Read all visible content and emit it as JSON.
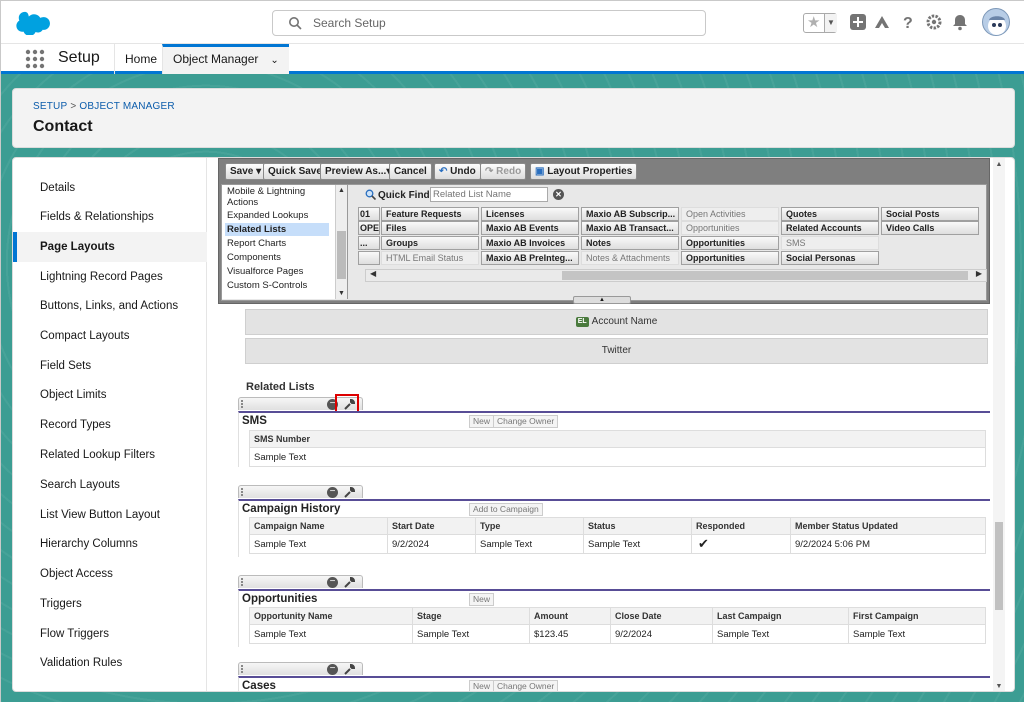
{
  "header": {
    "search_placeholder": "Search Setup",
    "icons": [
      "cloud-logo",
      "search-icon",
      "star-icon",
      "chevron-down-icon",
      "plus-icon",
      "trailhead-icon",
      "help-icon",
      "gear-icon",
      "bell-icon",
      "avatar"
    ]
  },
  "appnav": {
    "app_name": "Setup",
    "tabs": [
      {
        "label": "Home"
      },
      {
        "label": "Object Manager"
      }
    ]
  },
  "breadcrumb": {
    "part1": "SETUP",
    "separator": ">",
    "part2": "OBJECT MANAGER"
  },
  "page_title": "Contact",
  "sidebar": {
    "items": [
      {
        "label": "Details"
      },
      {
        "label": "Fields & Relationships"
      },
      {
        "label": "Page Layouts"
      },
      {
        "label": "Lightning Record Pages"
      },
      {
        "label": "Buttons, Links, and Actions"
      },
      {
        "label": "Compact Layouts"
      },
      {
        "label": "Field Sets"
      },
      {
        "label": "Object Limits"
      },
      {
        "label": "Record Types"
      },
      {
        "label": "Related Lookup Filters"
      },
      {
        "label": "Search Layouts"
      },
      {
        "label": "List View Button Layout"
      },
      {
        "label": "Hierarchy Columns"
      },
      {
        "label": "Object Access"
      },
      {
        "label": "Triggers"
      },
      {
        "label": "Flow Triggers"
      },
      {
        "label": "Validation Rules"
      }
    ],
    "active": "Page Layouts"
  },
  "toolbar": {
    "save": "Save",
    "quick_save": "Quick Save",
    "preview_as": "Preview As...",
    "cancel": "Cancel",
    "undo": "Undo",
    "redo": "Redo",
    "layout_properties": "Layout Properties"
  },
  "palette": {
    "categories": [
      "Mobile & Lightning Actions",
      "Expanded Lookups",
      "Related Lists",
      "Report Charts",
      "Components",
      "Visualforce Pages",
      "Custom S-Controls"
    ],
    "selected_category": "Related Lists",
    "quick_find_label": "Quick Find",
    "quick_find_placeholder": "Related List Name",
    "col0": [
      "01",
      "OPE...",
      "...",
      ""
    ],
    "col1": [
      "Feature Requests",
      "Files",
      "Groups",
      "HTML Email Status"
    ],
    "col2": [
      "Licenses",
      "Maxio AB Events",
      "Maxio AB Invoices",
      "Maxio AB PreInteg..."
    ],
    "col3": [
      "Maxio AB Subscrip...",
      "Maxio AB Transact...",
      "Notes",
      "Notes & Attachments"
    ],
    "col4": [
      "Open Activities",
      "Opportunities",
      "Opportunities",
      "Opportunities"
    ],
    "col5": [
      "Quotes",
      "Related Accounts",
      "SMS",
      "Social Personas"
    ],
    "col6": [
      "Social Posts",
      "Video Calls",
      "",
      ""
    ]
  },
  "fields": {
    "account_name": "Account Name",
    "account_name_badge": "EL",
    "twitter": "Twitter"
  },
  "related_lists_title": "Related Lists",
  "related_lists": [
    {
      "name": "SMS",
      "buttons": [
        "New",
        "Change Owner"
      ],
      "columns": [
        "SMS Number"
      ],
      "row": [
        "Sample Text"
      ]
    },
    {
      "name": "Campaign History",
      "buttons": [
        "Add to Campaign"
      ],
      "columns": [
        "Campaign Name",
        "Start Date",
        "Type",
        "Status",
        "Responded",
        "Member Status Updated"
      ],
      "row": [
        "Sample Text",
        "9/2/2024",
        "Sample Text",
        "Sample Text",
        "✔",
        "9/2/2024 5:06 PM"
      ]
    },
    {
      "name": "Opportunities",
      "buttons": [
        "New"
      ],
      "columns": [
        "Opportunity Name",
        "Stage",
        "Amount",
        "Close Date",
        "Last Campaign",
        "First Campaign"
      ],
      "row": [
        "Sample Text",
        "Sample Text",
        "$123.45",
        "9/2/2024",
        "Sample Text",
        "Sample Text"
      ]
    },
    {
      "name": "Cases",
      "buttons": [
        "New",
        "Change Owner"
      ],
      "columns": [],
      "row": []
    }
  ],
  "colors": {
    "brand": "#0176d3",
    "teal": "#3c9d93",
    "related_list_bar": "#584d96",
    "highlight": "#dd0000"
  }
}
